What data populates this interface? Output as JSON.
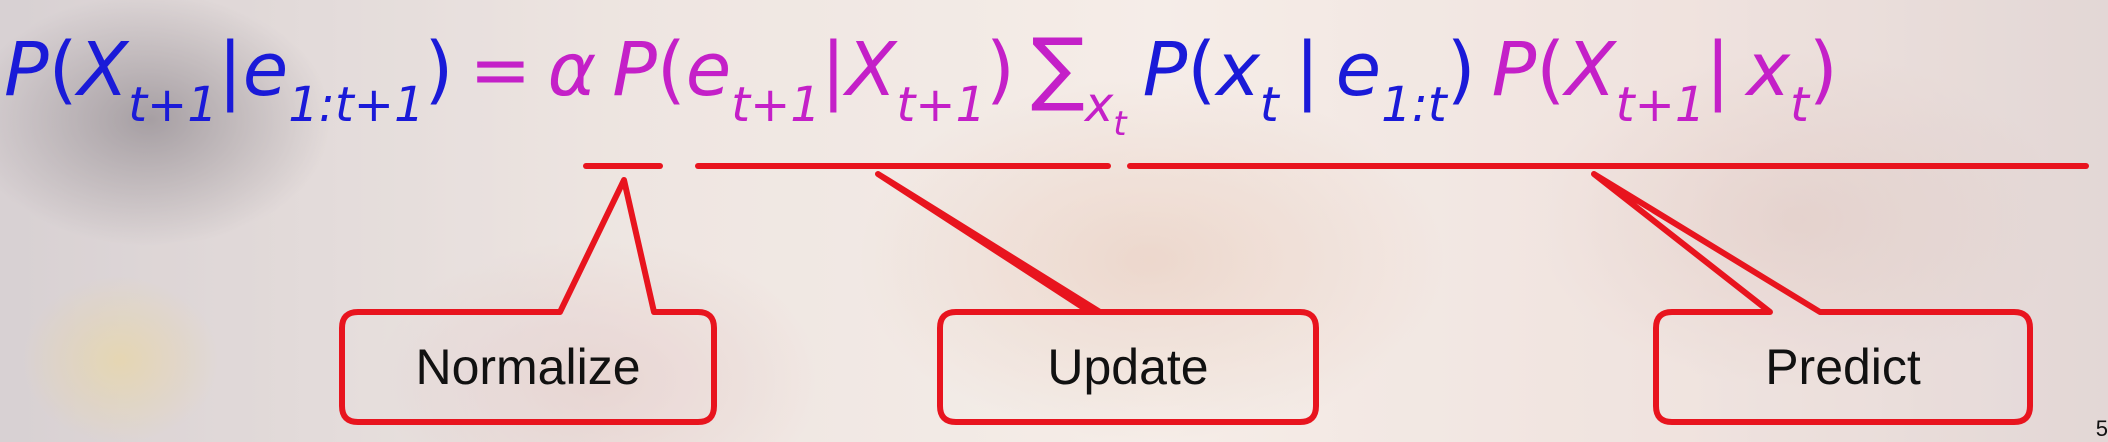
{
  "formula": {
    "lhs": {
      "p": "P",
      "open": "(",
      "x": "X",
      "x_sub": "t+1",
      "bar": "|",
      "e": "e",
      "e_sub": "1:t+1",
      "close": ")"
    },
    "equals": "=",
    "alpha": "α",
    "update": {
      "p": "P",
      "open": "(",
      "e": "e",
      "e_sub": "t+1",
      "bar": "|",
      "x": "X",
      "x_sub": "t+1",
      "close": ")"
    },
    "sum": "∑",
    "sum_var": "x",
    "sum_var_sub": "t",
    "filter": {
      "p": "P",
      "open": "(",
      "x": "x",
      "x_sub": "t",
      "bar": "|",
      "e": "e",
      "e_sub": "1:t",
      "close": ")"
    },
    "transition": {
      "p": "P",
      "open": "(",
      "x": "X",
      "x_sub": "t+1",
      "bar": "|",
      "xt": "x",
      "xt_sub": "t",
      "close": ")"
    }
  },
  "callouts": {
    "normalize": "Normalize",
    "update": "Update",
    "predict": "Predict"
  },
  "colors": {
    "blue_text": "#1a1ad8",
    "pink_text": "#c420c8",
    "callout_stroke": "#e8141e"
  },
  "page_number": "5"
}
